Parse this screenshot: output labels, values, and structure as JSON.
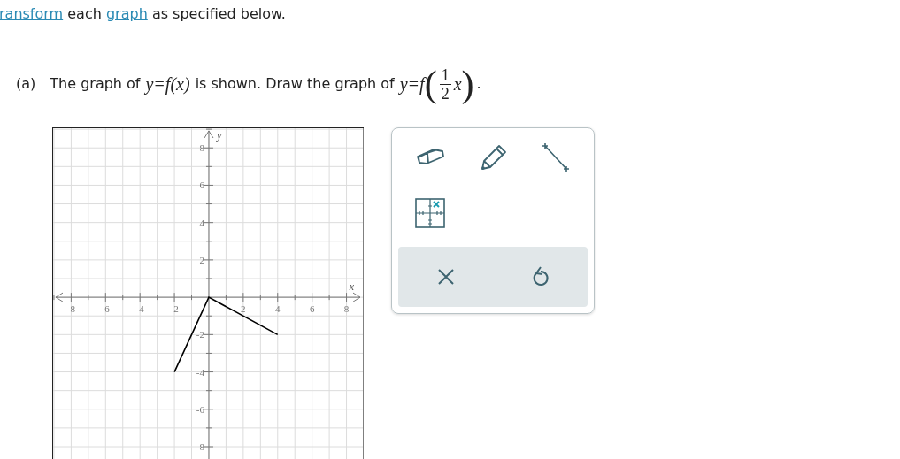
{
  "instruction": {
    "segments": [
      {
        "kind": "link",
        "text": "ransform"
      },
      {
        "kind": "text",
        "text": "each"
      },
      {
        "kind": "link",
        "text": "graph"
      },
      {
        "kind": "text",
        "text": "as specified below."
      }
    ]
  },
  "question": {
    "label": "(a)",
    "segments": [
      {
        "kind": "text",
        "text": "The graph of"
      },
      {
        "kind": "math",
        "text": "y=f(x)"
      },
      {
        "kind": "text",
        "text": "is shown. Draw the graph of"
      },
      {
        "kind": "math",
        "text": "y=f"
      },
      {
        "kind": "paren_frac",
        "open": "(",
        "numerator": "1",
        "denominator": "2",
        "after": "x",
        "close": ")"
      },
      {
        "kind": "text",
        "text": "."
      }
    ]
  },
  "graph": {
    "chart_data": {
      "type": "line",
      "grid": true,
      "xlabel": "x",
      "ylabel": "y",
      "x": [
        -2,
        0,
        4
      ],
      "series": [
        {
          "color": "#000000",
          "values": [
            -4,
            0,
            -2
          ]
        }
      ],
      "xlim": [
        -9.1,
        9
      ],
      "ylim": [
        -8.9,
        9.1
      ],
      "xticks": [
        -8,
        -6,
        -4,
        -2,
        2,
        4,
        6,
        8
      ],
      "yticks": [
        -8,
        -6,
        -4,
        -2,
        2,
        4,
        6,
        8
      ]
    }
  },
  "toolbar": {
    "tools": [
      {
        "kind": "eraser"
      },
      {
        "kind": "pencil"
      },
      {
        "kind": "line"
      },
      {
        "kind": "point"
      }
    ],
    "actions": [
      {
        "kind": "clear"
      },
      {
        "kind": "undo"
      }
    ]
  }
}
